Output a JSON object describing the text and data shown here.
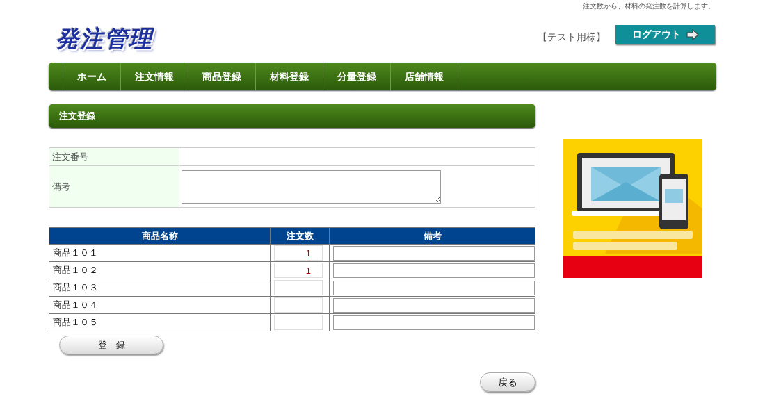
{
  "header": {
    "tagline": "注文数から、材料の発注数を計算します。",
    "logo": "発注管理",
    "user": "【テスト用様】",
    "logout": "ログアウト"
  },
  "nav": [
    {
      "label": "ホーム"
    },
    {
      "label": "注文情報"
    },
    {
      "label": "商品登録"
    },
    {
      "label": "材料登録"
    },
    {
      "label": "分量登録"
    },
    {
      "label": "店舗情報"
    }
  ],
  "section_title": "注文登録",
  "form": {
    "order_number_label": "注文番号",
    "note_label": "備考"
  },
  "table": {
    "columns": [
      "商品名称",
      "注文数",
      "備考"
    ],
    "rows": [
      {
        "name": "商品１０１",
        "quantity": "1"
      },
      {
        "name": "商品１０２",
        "quantity": "1"
      },
      {
        "name": "商品１０３"
      },
      {
        "name": "商品１０４"
      },
      {
        "name": "商品１０５"
      }
    ]
  },
  "register_button": "登　録",
  "back_button": "戻る"
}
